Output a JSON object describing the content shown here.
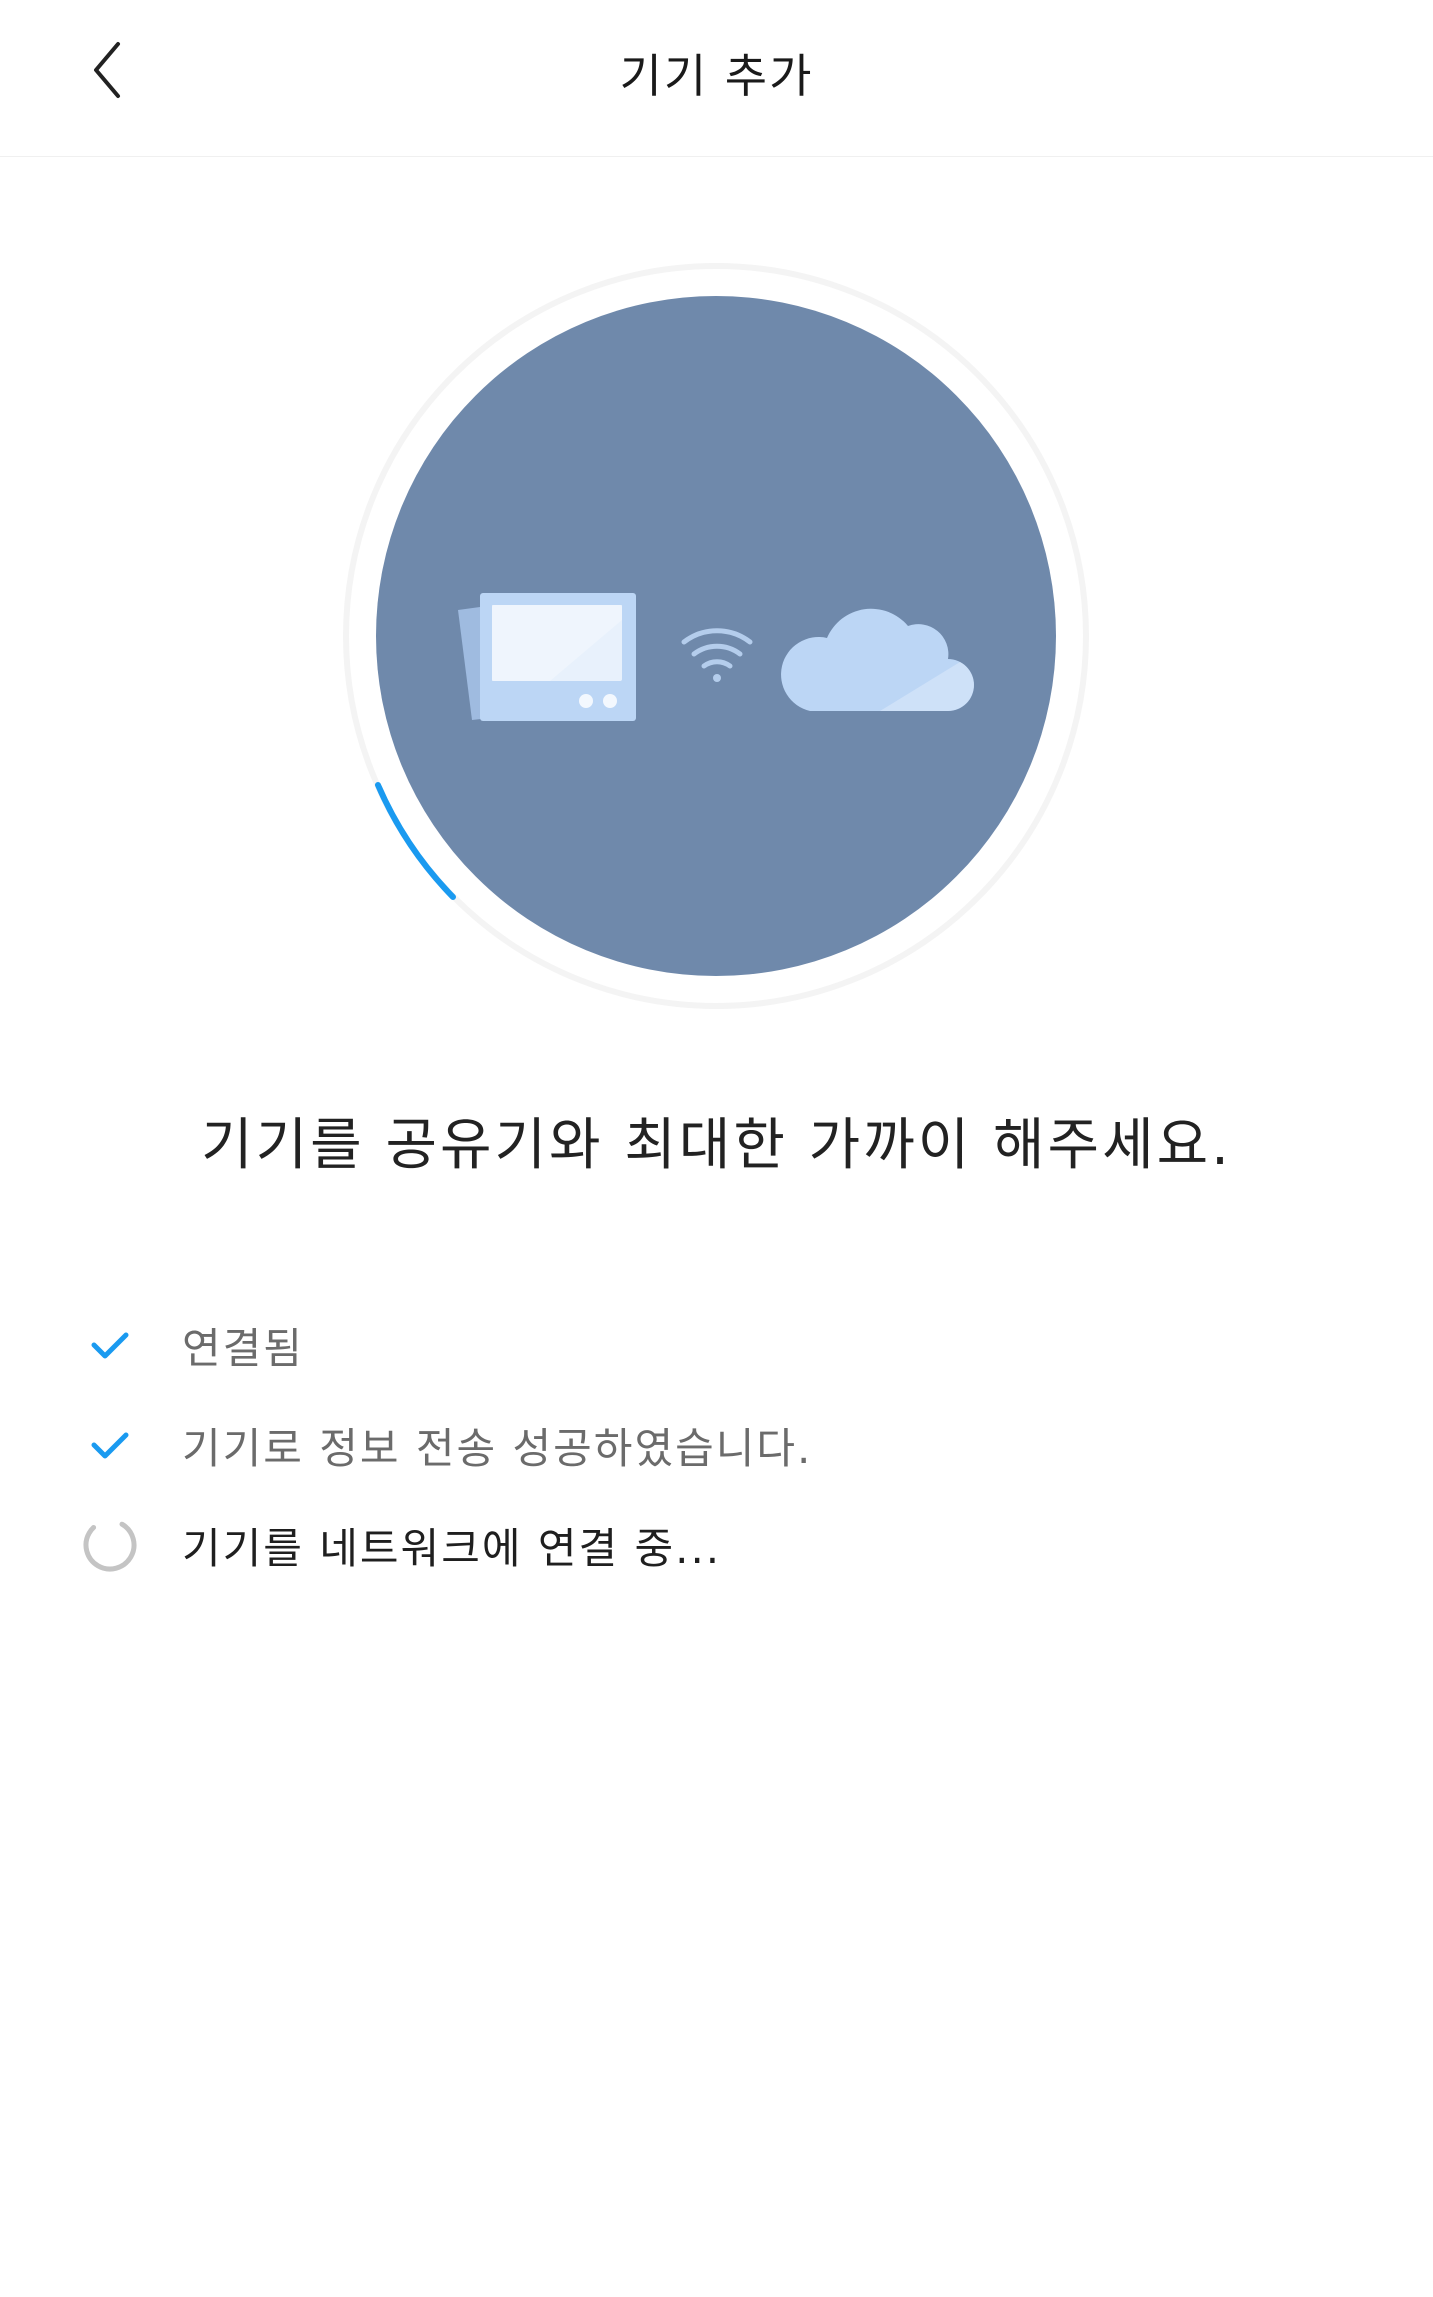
{
  "header": {
    "back_icon": "chevron-left-icon",
    "title": "기기 추가"
  },
  "illustration": {
    "circle_color": "#6f89ab",
    "progress_color": "#1a9af0",
    "device_icon": "tablet-device-icon",
    "wifi_icon": "wifi-icon",
    "cloud_icon": "cloud-icon",
    "accent_light": "#bcd6f5"
  },
  "headline": "기기를 공유기와 최대한 가까이 해주세요.",
  "steps": [
    {
      "label": "연결됨",
      "status": "done",
      "icon": "check-icon"
    },
    {
      "label": "기기로 정보 전송 성공하였습니다.",
      "status": "done",
      "icon": "check-icon"
    },
    {
      "label": "기기를 네트워크에 연결 중...",
      "status": "in-progress",
      "icon": "spinner-icon"
    }
  ]
}
